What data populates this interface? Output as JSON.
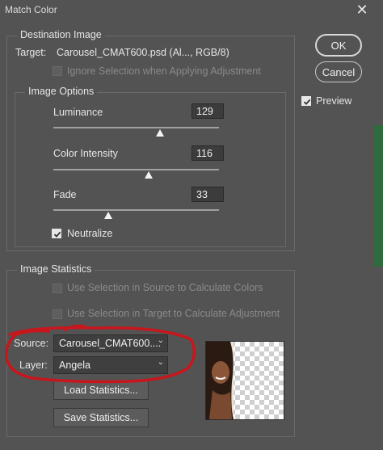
{
  "window": {
    "title": "Match Color"
  },
  "destination": {
    "legend": "Destination Image",
    "target_label": "Target:",
    "target_value": "Carousel_CMAT600.psd (Al..., RGB/8)",
    "ignore_selection_label": "Ignore Selection when Applying Adjustment"
  },
  "image_options": {
    "legend": "Image Options",
    "luminance": {
      "label": "Luminance",
      "value": "129",
      "min": 1,
      "max": 200
    },
    "color_intensity": {
      "label": "Color Intensity",
      "value": "116",
      "min": 1,
      "max": 200
    },
    "fade": {
      "label": "Fade",
      "value": "33",
      "min": 0,
      "max": 100
    },
    "neutralize_label": "Neutralize",
    "neutralize_checked": true
  },
  "statistics": {
    "legend": "Image Statistics",
    "use_source_label": "Use Selection in Source to Calculate Colors",
    "use_target_label": "Use Selection in Target to Calculate Adjustment",
    "source_label": "Source:",
    "source_value": "Carousel_CMAT600....",
    "layer_label": "Layer:",
    "layer_value": "Angela",
    "load_button": "Load Statistics...",
    "save_button": "Save Statistics..."
  },
  "actions": {
    "ok": "OK",
    "cancel": "Cancel",
    "preview_label": "Preview",
    "preview_checked": true
  },
  "colors": {
    "annotation": "#c8161d",
    "background": "#535353"
  }
}
